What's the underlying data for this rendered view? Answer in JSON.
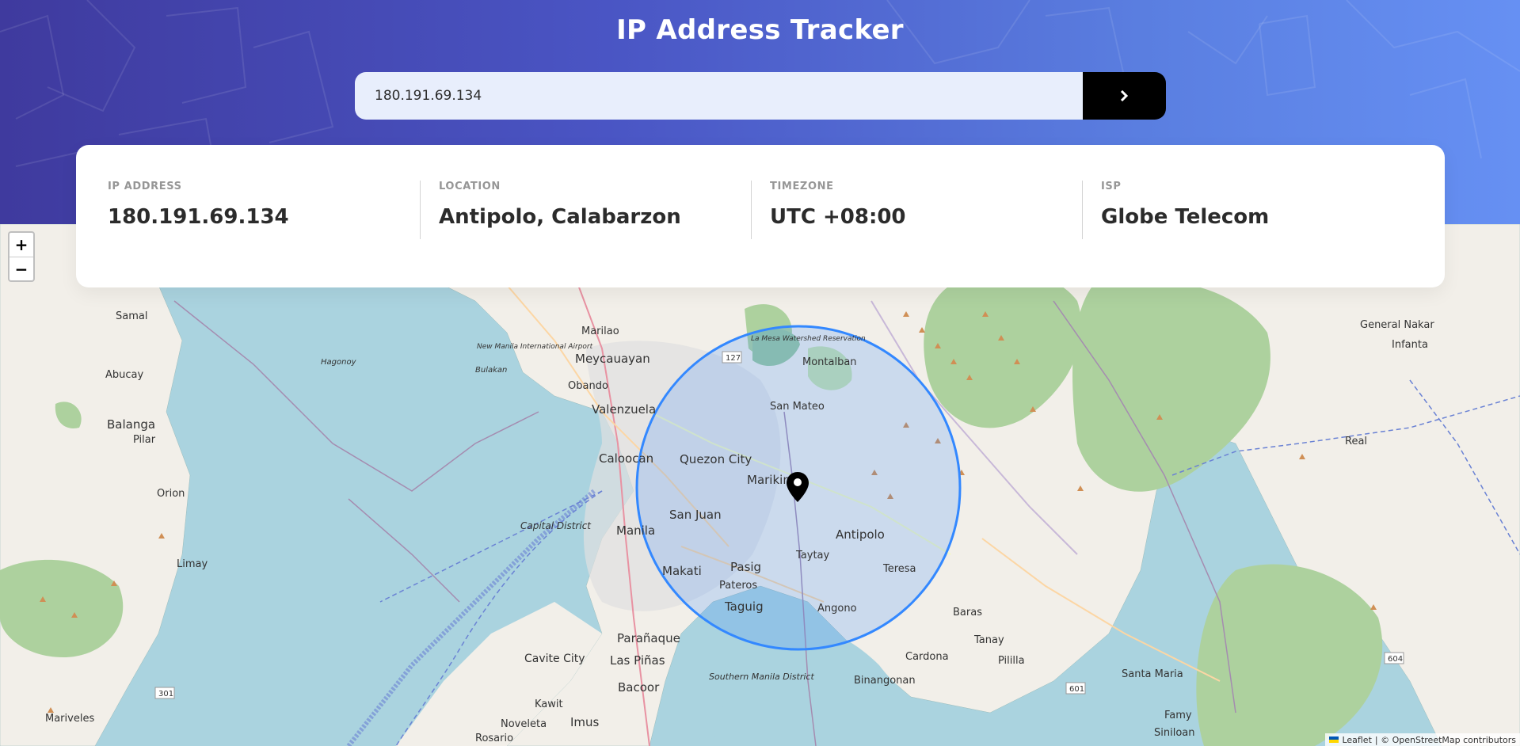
{
  "header": {
    "title": "IP Address Tracker"
  },
  "search": {
    "value": "180.191.69.134",
    "button_icon": "chevron-right-icon"
  },
  "info": [
    {
      "label": "IP ADDRESS",
      "value": "180.191.69.134"
    },
    {
      "label": "LOCATION",
      "value": "Antipolo, Calabarzon"
    },
    {
      "label": "TIMEZONE",
      "value": "UTC +08:00"
    },
    {
      "label": "ISP",
      "value": "Globe Telecom"
    }
  ],
  "map": {
    "zoom_in": "+",
    "zoom_out": "−",
    "marker_icon": "location-pin-icon",
    "labels": {
      "samal": "Samal",
      "abucay": "Abucay",
      "balanga": "Balanga",
      "pilar": "Pilar",
      "orion": "Orion",
      "limay": "Limay",
      "mariveles": "Mariveles",
      "marilao": "Marilao",
      "meycauayan": "Meycauayan",
      "obando": "Obando",
      "valenzuela": "Valenzuela",
      "caloocan": "Caloocan",
      "quezon_city": "Quezon City",
      "marikina": "Marikina",
      "san_juan": "San Juan",
      "manila": "Manila",
      "makati": "Makati",
      "pasig": "Pasig",
      "pateros": "Pateros",
      "taguig": "Taguig",
      "antipolo": "Antipolo",
      "taytay": "Taytay",
      "teresa": "Teresa",
      "angono": "Angono",
      "san_mateo": "San Mateo",
      "montalban": "Montalban",
      "paranaque": "Parañaque",
      "las_pinas": "Las Piñas",
      "cavite_city": "Cavite City",
      "bacoor": "Bacoor",
      "kawit": "Kawit",
      "noveleta": "Noveleta",
      "imus": "Imus",
      "rosario": "Rosario",
      "baras": "Baras",
      "tanay": "Tanay",
      "cardona": "Cardona",
      "binangonan": "Binangonan",
      "pililla": "Pililla",
      "santa_maria": "Santa Maria",
      "famy": "Famy",
      "siniloan": "Siniloan",
      "real": "Real",
      "infanta": "Infanta",
      "general_nakar": "General Nakar",
      "capital_district": "Capital District",
      "southern_manila_district": "Southern Manila District",
      "new_manila_airport": "New Manila International Airport",
      "la_mesa": "La Mesa Watershed Reservation",
      "bulakan": "Bulakan",
      "hagonoy": "Hagonoy",
      "road_127": "127",
      "road_301": "301",
      "road_601": "601",
      "road_604": "604"
    },
    "attribution_leaflet": "Leaflet",
    "attribution_osm": "| © OpenStreetMap contributors"
  },
  "colors": {
    "header_gradient_start": "#3f3a9e",
    "header_gradient_end": "#6690f3",
    "search_button": "#000000",
    "circle_stroke": "#3388ff",
    "water": "#aad3df",
    "land": "#f2efe9",
    "forest": "#add19e"
  }
}
